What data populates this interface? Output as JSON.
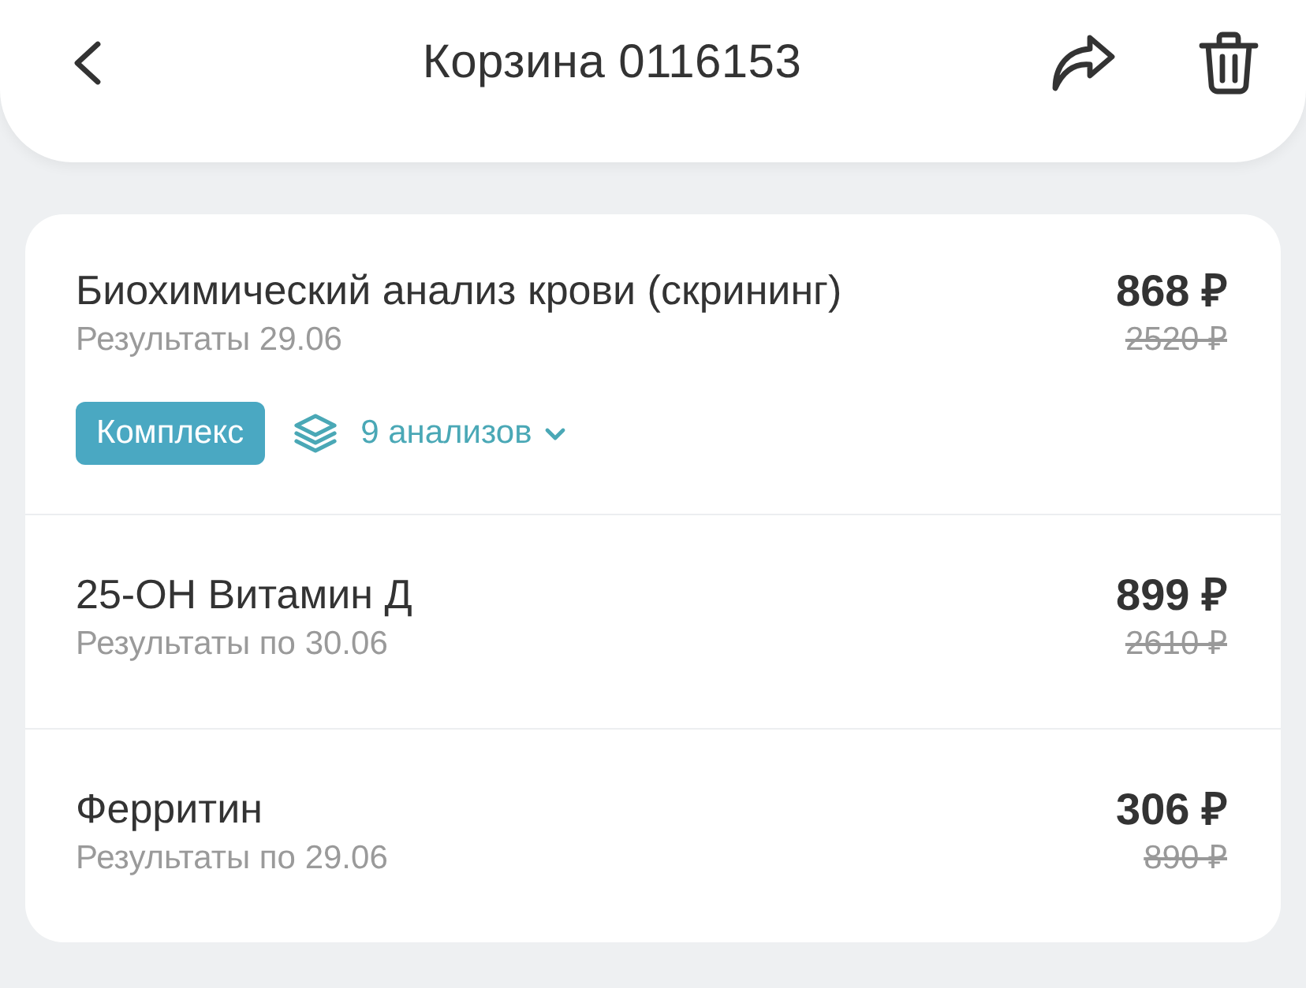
{
  "header": {
    "title": "Корзина 0116153"
  },
  "items": [
    {
      "name": "Биохимический анализ крови (скрининг)",
      "results": "Результаты 29.06",
      "price": "868 ₽",
      "old_price": "2520 ₽",
      "badge": "Комплекс",
      "analyses": {
        "label": "9 анализов",
        "expanded": false
      }
    },
    {
      "name": "25-ОН Витамин Д",
      "results": "Результаты по 30.06",
      "price": "899 ₽",
      "old_price": "2610 ₽"
    },
    {
      "name": "Ферритин",
      "results": "Результаты по 29.06",
      "price": "306 ₽",
      "old_price": "890 ₽"
    }
  ]
}
